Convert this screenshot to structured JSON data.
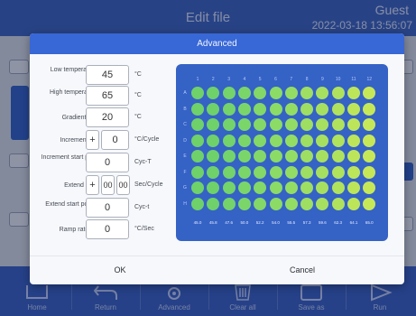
{
  "background": {
    "title": "Edit file",
    "user": "Guest",
    "datetime": "2022-03-18 13:56:07",
    "nav": [
      {
        "label": "Home"
      },
      {
        "label": "Return"
      },
      {
        "label": "Advanced"
      },
      {
        "label": "Clear all"
      },
      {
        "label": "Save as"
      },
      {
        "label": "Run"
      }
    ]
  },
  "dialog": {
    "title": "Advanced",
    "params": [
      {
        "label": "Low temperature",
        "value": "45",
        "unit": "°C"
      },
      {
        "label": "High temperature",
        "value": "65",
        "unit": "°C"
      },
      {
        "label": "Gradient",
        "value": "20",
        "unit": "°C"
      },
      {
        "label": "Increment",
        "sign": "+",
        "value": "0",
        "unit": "°C/Cycle"
      },
      {
        "label": "Increment start position",
        "value": "0",
        "unit": "Cyc-T"
      },
      {
        "label": "Extend",
        "sign": "+",
        "minutes": "00",
        "seconds": "00",
        "unit": "Sec/Cycle"
      },
      {
        "label": "Extend start position",
        "value": "0",
        "unit": "Cyc-t"
      },
      {
        "label": "Ramp rate",
        "value": "0",
        "unit": "°C/Sec"
      }
    ],
    "plate": {
      "columns": [
        "1",
        "2",
        "3",
        "4",
        "5",
        "6",
        "7",
        "8",
        "9",
        "10",
        "11",
        "12"
      ],
      "rows": [
        "A",
        "B",
        "C",
        "D",
        "E",
        "F",
        "G",
        "H"
      ],
      "column_temperatures": [
        "45.0",
        "45.8",
        "47.6",
        "50.0",
        "52.2",
        "54.0",
        "55.5",
        "57.3",
        "59.6",
        "62.3",
        "64.1",
        "65.0"
      ],
      "well_colors": [
        "#6fd16a",
        "#6fd16a",
        "#74d36a",
        "#7bd66a",
        "#83d867",
        "#8bdb66",
        "#94dd64",
        "#9ede62",
        "#a7e060",
        "#b0e25e",
        "#bde55a",
        "#c6e858"
      ]
    },
    "ok_label": "OK",
    "cancel_label": "Cancel"
  }
}
